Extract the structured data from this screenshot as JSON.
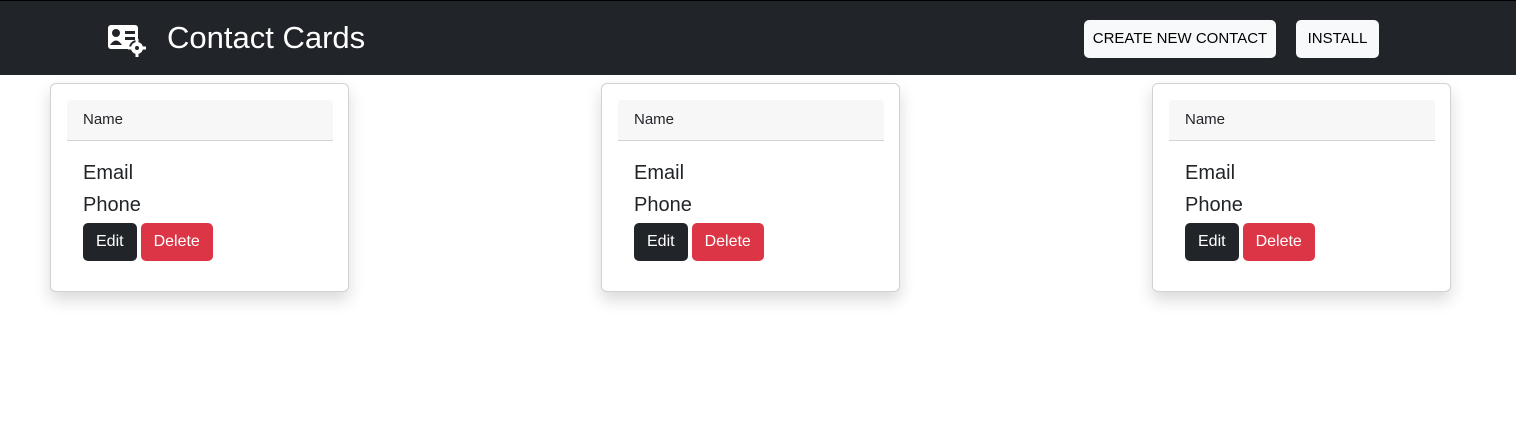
{
  "navbar": {
    "brand_icon": "contact-card-gear-icon",
    "title": "Contact Cards",
    "create_label": "CREATE NEW CONTACT",
    "install_label": "INSTALL",
    "background": "#212529"
  },
  "cards": [
    {
      "name": "Name",
      "email": "Email",
      "phone": "Phone",
      "edit_label": "Edit",
      "delete_label": "Delete"
    },
    {
      "name": "Name",
      "email": "Email",
      "phone": "Phone",
      "edit_label": "Edit",
      "delete_label": "Delete"
    },
    {
      "name": "Name",
      "email": "Email",
      "phone": "Phone",
      "edit_label": "Edit",
      "delete_label": "Delete"
    }
  ],
  "colors": {
    "edit": "#212529",
    "delete": "#dc3545"
  }
}
